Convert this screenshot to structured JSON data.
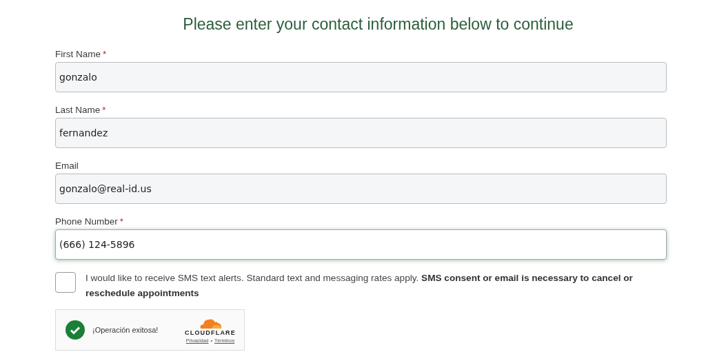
{
  "heading": "Please enter your contact information below to continue",
  "fields": [
    {
      "label": "First Name",
      "required": true,
      "value": "gonzalo",
      "focused": false
    },
    {
      "label": "Last Name",
      "required": true,
      "value": "fernandez",
      "focused": false
    },
    {
      "label": "Email",
      "required": false,
      "value": "gonzalo@real-id.us",
      "focused": false
    },
    {
      "label": "Phone Number",
      "required": true,
      "value": "(666) 124-5896",
      "focused": true
    }
  ],
  "required_mark": "*",
  "sms_consent": {
    "checked": false,
    "text": "I would like to receive SMS text alerts. Standard text and messaging rates apply. **SMS consent or email is necessary to cancel or reschedule appointments**"
  },
  "captcha": {
    "status": "¡Operación exitosa!",
    "success": true,
    "brand": "CLOUDFLARE",
    "links": [
      "Privacidad",
      "Términos"
    ],
    "separator": "•"
  }
}
